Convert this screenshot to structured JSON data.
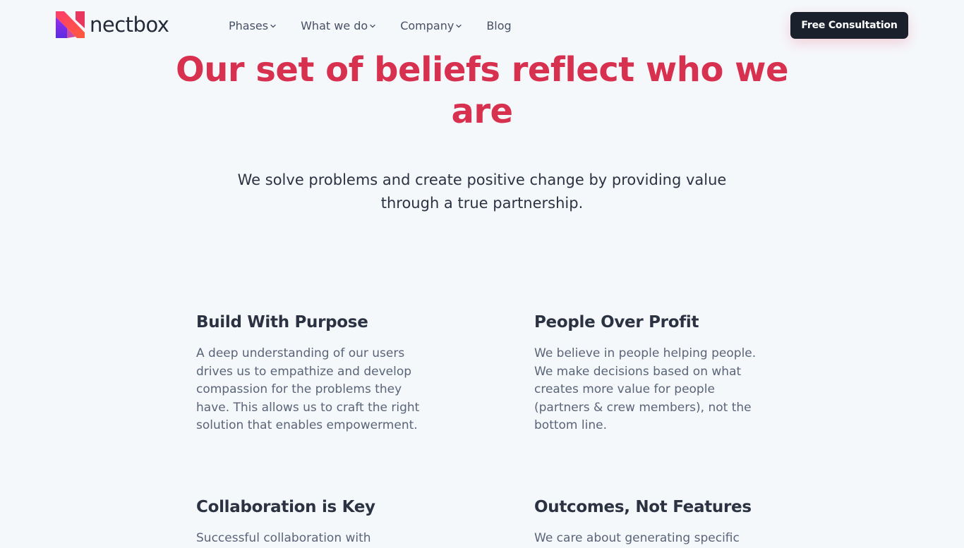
{
  "header": {
    "brand": "nectbox",
    "nav": [
      {
        "label": "Phases",
        "has_dropdown": true
      },
      {
        "label": "What we do",
        "has_dropdown": true
      },
      {
        "label": "Company",
        "has_dropdown": true
      },
      {
        "label": "Blog",
        "has_dropdown": false
      }
    ],
    "cta_label": "Free Consultation",
    "icons": {
      "logo": "nectbox-logo-icon",
      "dropdown": "chevron-down-icon"
    }
  },
  "hero": {
    "title": "Our set of beliefs reflect who we are",
    "subtitle": "We solve problems and create positive change by providing value through a true partnership."
  },
  "beliefs": [
    {
      "title": "Build With Purpose",
      "text": "A deep understanding of our users drives us to empathize and develop compassion for the problems they have. This allows us to craft the right solution that enables empowerment."
    },
    {
      "title": "People Over Profit",
      "text": "We believe in people helping people. We make decisions based on what creates more value for people (partners & crew members), not the bottom line."
    },
    {
      "title": "Collaboration is Key",
      "text": "Successful collaboration with"
    },
    {
      "title": "Outcomes, Not Features",
      "text": "We care about generating specific"
    }
  ],
  "colors": {
    "background": "#f5f8fb",
    "accent": "#d8304f",
    "heading": "#2b3343",
    "body_text": "#5a6478",
    "button": "#1a202c",
    "logo_gradient": [
      "#ff3d6b",
      "#7a2cf0"
    ]
  }
}
